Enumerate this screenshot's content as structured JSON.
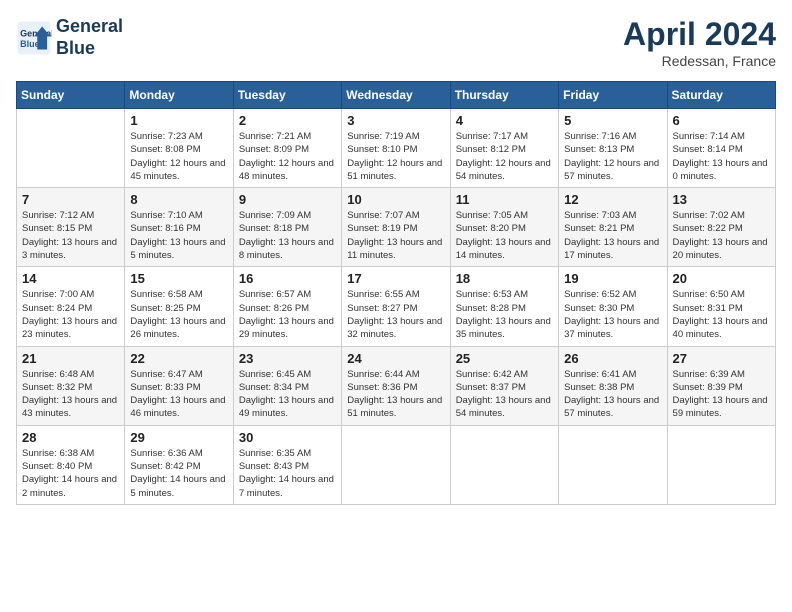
{
  "header": {
    "logo_line1": "General",
    "logo_line2": "Blue",
    "month": "April 2024",
    "location": "Redessan, France"
  },
  "weekdays": [
    "Sunday",
    "Monday",
    "Tuesday",
    "Wednesday",
    "Thursday",
    "Friday",
    "Saturday"
  ],
  "weeks": [
    [
      {
        "day": "",
        "sunrise": "",
        "sunset": "",
        "daylight": ""
      },
      {
        "day": "1",
        "sunrise": "Sunrise: 7:23 AM",
        "sunset": "Sunset: 8:08 PM",
        "daylight": "Daylight: 12 hours and 45 minutes."
      },
      {
        "day": "2",
        "sunrise": "Sunrise: 7:21 AM",
        "sunset": "Sunset: 8:09 PM",
        "daylight": "Daylight: 12 hours and 48 minutes."
      },
      {
        "day": "3",
        "sunrise": "Sunrise: 7:19 AM",
        "sunset": "Sunset: 8:10 PM",
        "daylight": "Daylight: 12 hours and 51 minutes."
      },
      {
        "day": "4",
        "sunrise": "Sunrise: 7:17 AM",
        "sunset": "Sunset: 8:12 PM",
        "daylight": "Daylight: 12 hours and 54 minutes."
      },
      {
        "day": "5",
        "sunrise": "Sunrise: 7:16 AM",
        "sunset": "Sunset: 8:13 PM",
        "daylight": "Daylight: 12 hours and 57 minutes."
      },
      {
        "day": "6",
        "sunrise": "Sunrise: 7:14 AM",
        "sunset": "Sunset: 8:14 PM",
        "daylight": "Daylight: 13 hours and 0 minutes."
      }
    ],
    [
      {
        "day": "7",
        "sunrise": "Sunrise: 7:12 AM",
        "sunset": "Sunset: 8:15 PM",
        "daylight": "Daylight: 13 hours and 3 minutes."
      },
      {
        "day": "8",
        "sunrise": "Sunrise: 7:10 AM",
        "sunset": "Sunset: 8:16 PM",
        "daylight": "Daylight: 13 hours and 5 minutes."
      },
      {
        "day": "9",
        "sunrise": "Sunrise: 7:09 AM",
        "sunset": "Sunset: 8:18 PM",
        "daylight": "Daylight: 13 hours and 8 minutes."
      },
      {
        "day": "10",
        "sunrise": "Sunrise: 7:07 AM",
        "sunset": "Sunset: 8:19 PM",
        "daylight": "Daylight: 13 hours and 11 minutes."
      },
      {
        "day": "11",
        "sunrise": "Sunrise: 7:05 AM",
        "sunset": "Sunset: 8:20 PM",
        "daylight": "Daylight: 13 hours and 14 minutes."
      },
      {
        "day": "12",
        "sunrise": "Sunrise: 7:03 AM",
        "sunset": "Sunset: 8:21 PM",
        "daylight": "Daylight: 13 hours and 17 minutes."
      },
      {
        "day": "13",
        "sunrise": "Sunrise: 7:02 AM",
        "sunset": "Sunset: 8:22 PM",
        "daylight": "Daylight: 13 hours and 20 minutes."
      }
    ],
    [
      {
        "day": "14",
        "sunrise": "Sunrise: 7:00 AM",
        "sunset": "Sunset: 8:24 PM",
        "daylight": "Daylight: 13 hours and 23 minutes."
      },
      {
        "day": "15",
        "sunrise": "Sunrise: 6:58 AM",
        "sunset": "Sunset: 8:25 PM",
        "daylight": "Daylight: 13 hours and 26 minutes."
      },
      {
        "day": "16",
        "sunrise": "Sunrise: 6:57 AM",
        "sunset": "Sunset: 8:26 PM",
        "daylight": "Daylight: 13 hours and 29 minutes."
      },
      {
        "day": "17",
        "sunrise": "Sunrise: 6:55 AM",
        "sunset": "Sunset: 8:27 PM",
        "daylight": "Daylight: 13 hours and 32 minutes."
      },
      {
        "day": "18",
        "sunrise": "Sunrise: 6:53 AM",
        "sunset": "Sunset: 8:28 PM",
        "daylight": "Daylight: 13 hours and 35 minutes."
      },
      {
        "day": "19",
        "sunrise": "Sunrise: 6:52 AM",
        "sunset": "Sunset: 8:30 PM",
        "daylight": "Daylight: 13 hours and 37 minutes."
      },
      {
        "day": "20",
        "sunrise": "Sunrise: 6:50 AM",
        "sunset": "Sunset: 8:31 PM",
        "daylight": "Daylight: 13 hours and 40 minutes."
      }
    ],
    [
      {
        "day": "21",
        "sunrise": "Sunrise: 6:48 AM",
        "sunset": "Sunset: 8:32 PM",
        "daylight": "Daylight: 13 hours and 43 minutes."
      },
      {
        "day": "22",
        "sunrise": "Sunrise: 6:47 AM",
        "sunset": "Sunset: 8:33 PM",
        "daylight": "Daylight: 13 hours and 46 minutes."
      },
      {
        "day": "23",
        "sunrise": "Sunrise: 6:45 AM",
        "sunset": "Sunset: 8:34 PM",
        "daylight": "Daylight: 13 hours and 49 minutes."
      },
      {
        "day": "24",
        "sunrise": "Sunrise: 6:44 AM",
        "sunset": "Sunset: 8:36 PM",
        "daylight": "Daylight: 13 hours and 51 minutes."
      },
      {
        "day": "25",
        "sunrise": "Sunrise: 6:42 AM",
        "sunset": "Sunset: 8:37 PM",
        "daylight": "Daylight: 13 hours and 54 minutes."
      },
      {
        "day": "26",
        "sunrise": "Sunrise: 6:41 AM",
        "sunset": "Sunset: 8:38 PM",
        "daylight": "Daylight: 13 hours and 57 minutes."
      },
      {
        "day": "27",
        "sunrise": "Sunrise: 6:39 AM",
        "sunset": "Sunset: 8:39 PM",
        "daylight": "Daylight: 13 hours and 59 minutes."
      }
    ],
    [
      {
        "day": "28",
        "sunrise": "Sunrise: 6:38 AM",
        "sunset": "Sunset: 8:40 PM",
        "daylight": "Daylight: 14 hours and 2 minutes."
      },
      {
        "day": "29",
        "sunrise": "Sunrise: 6:36 AM",
        "sunset": "Sunset: 8:42 PM",
        "daylight": "Daylight: 14 hours and 5 minutes."
      },
      {
        "day": "30",
        "sunrise": "Sunrise: 6:35 AM",
        "sunset": "Sunset: 8:43 PM",
        "daylight": "Daylight: 14 hours and 7 minutes."
      },
      {
        "day": "",
        "sunrise": "",
        "sunset": "",
        "daylight": ""
      },
      {
        "day": "",
        "sunrise": "",
        "sunset": "",
        "daylight": ""
      },
      {
        "day": "",
        "sunrise": "",
        "sunset": "",
        "daylight": ""
      },
      {
        "day": "",
        "sunrise": "",
        "sunset": "",
        "daylight": ""
      }
    ]
  ]
}
